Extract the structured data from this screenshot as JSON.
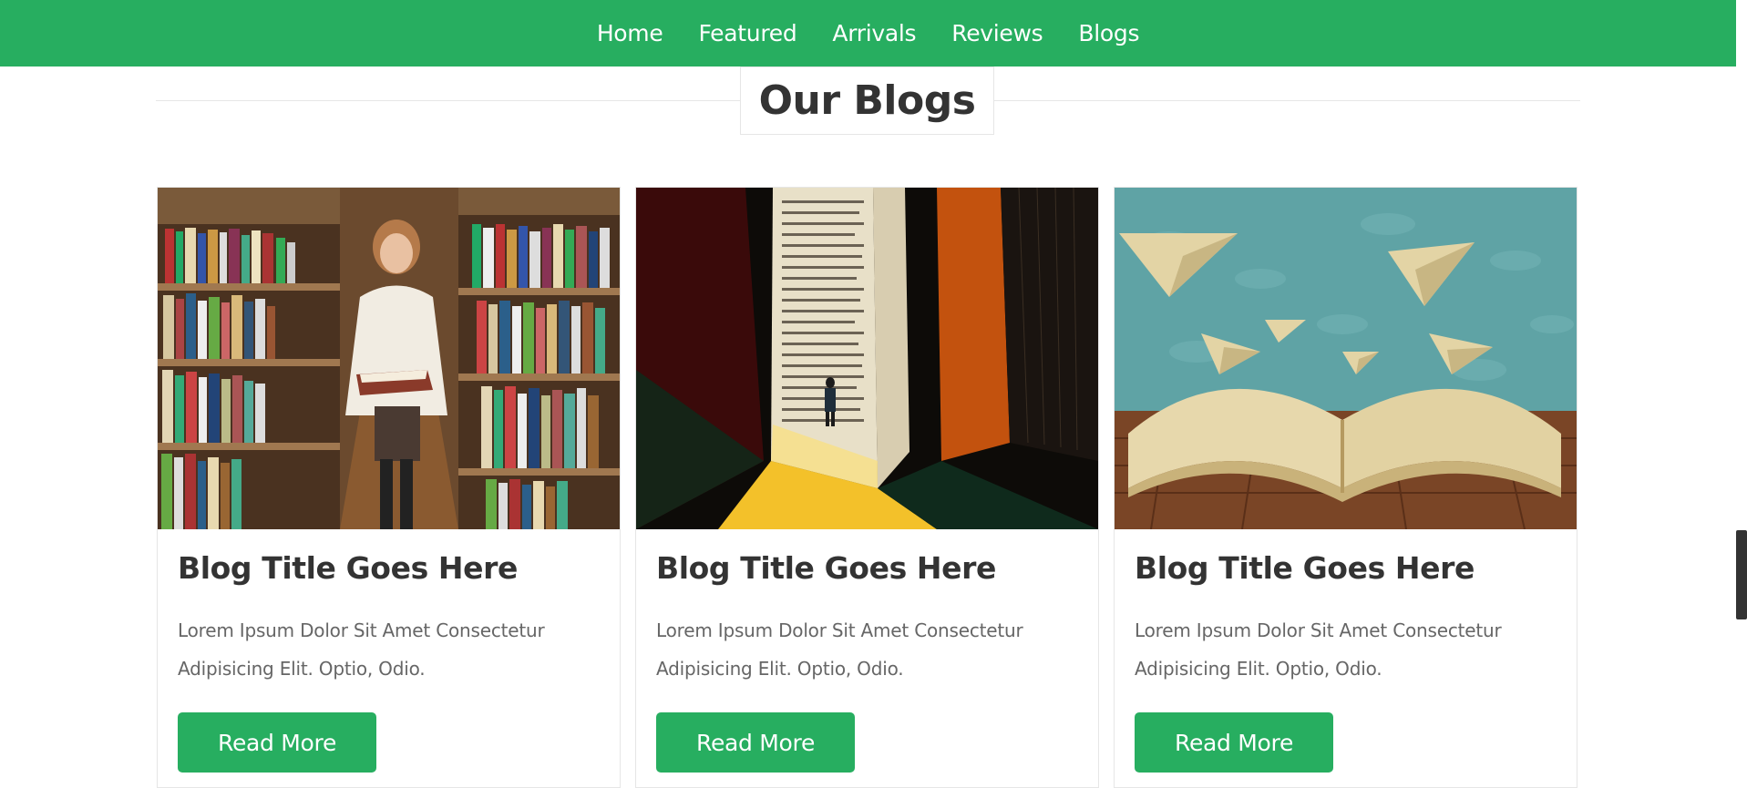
{
  "nav": {
    "items": [
      {
        "label": "Home"
      },
      {
        "label": "Featured"
      },
      {
        "label": "Arrivals"
      },
      {
        "label": "Reviews"
      },
      {
        "label": "Blogs"
      }
    ]
  },
  "section": {
    "heading": "Our Blogs"
  },
  "blogs": [
    {
      "title": "Blog Title Goes Here",
      "excerpt": "Lorem Ipsum Dolor Sit Amet Consectetur Adipisicing Elit. Optio, Odio.",
      "button": "Read More",
      "image": "woman-reading-in-library"
    },
    {
      "title": "Blog Title Goes Here",
      "excerpt": "Lorem Ipsum Dolor Sit Amet Consectetur Adipisicing Elit. Optio, Odio.",
      "button": "Read More",
      "image": "man-standing-before-giant-book"
    },
    {
      "title": "Blog Title Goes Here",
      "excerpt": "Lorem Ipsum Dolor Sit Amet Consectetur Adipisicing Elit. Optio, Odio.",
      "button": "Read More",
      "image": "paper-planes-over-open-book"
    }
  ],
  "colors": {
    "accent": "#27ae60",
    "heading": "#333333",
    "text": "#666666",
    "border": "#e6e6e6"
  }
}
